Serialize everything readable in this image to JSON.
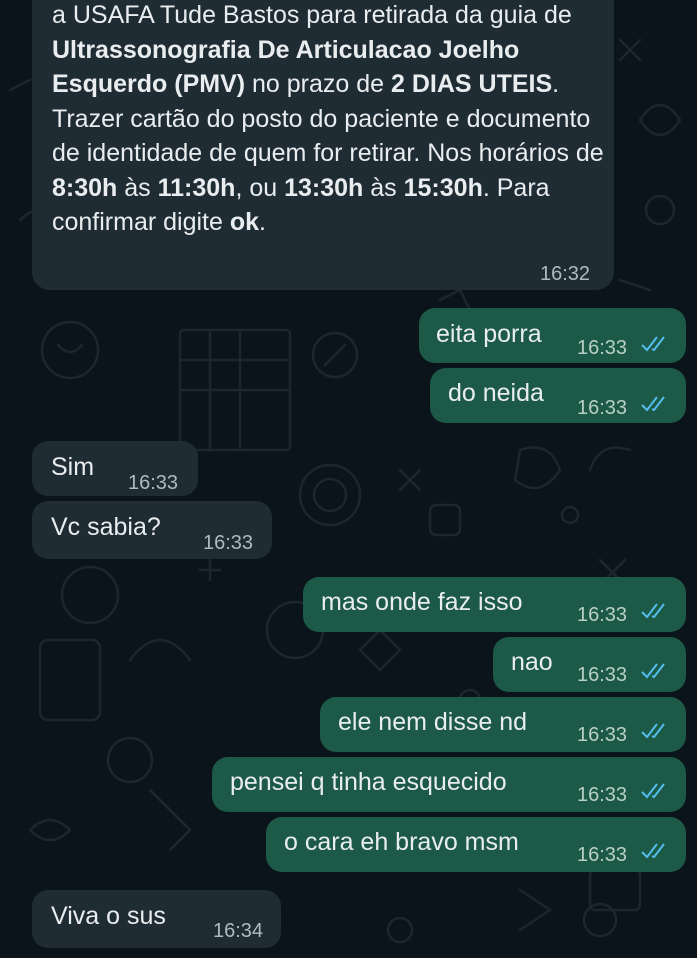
{
  "colors": {
    "background": "#0b141a",
    "incoming_bubble": "#202c33",
    "outgoing_bubble": "#1c5a47",
    "read_ticks": "#53bdeb"
  },
  "first_message": {
    "segments": [
      {
        "t": "a USAFA Tude Bastos para retirada da guia de ",
        "b": false
      },
      {
        "t": "Ultrassonografia De Articulacao Joelho Esquerdo (PMV)",
        "b": true
      },
      {
        "t": " no prazo de ",
        "b": false
      },
      {
        "t": "2 DIAS UTEIS",
        "b": true
      },
      {
        "t": ". Trazer cartão do posto do paciente e documento de identidade de quem for retirar. Nos horários de ",
        "b": false
      },
      {
        "t": "8:30h",
        "b": true
      },
      {
        "t": " às ",
        "b": false
      },
      {
        "t": "11:30h",
        "b": true
      },
      {
        "t": ", ou ",
        "b": false
      },
      {
        "t": "13:30h",
        "b": true
      },
      {
        "t": " às ",
        "b": false
      },
      {
        "t": "15:30h",
        "b": true
      },
      {
        "t": ". Para confirmar digite ",
        "b": false
      },
      {
        "t": "ok",
        "b": true
      },
      {
        "t": ".",
        "b": false
      }
    ],
    "time": "16:32"
  },
  "messages": [
    {
      "text": "eita porra",
      "time": "16:33",
      "outgoing": true,
      "read_icon": "double-check-icon"
    },
    {
      "text": "do neida",
      "time": "16:33",
      "outgoing": true,
      "read_icon": "double-check-icon"
    },
    {
      "text": "Sim",
      "time": "16:33",
      "outgoing": false
    },
    {
      "text": "Vc sabia?",
      "time": "16:33",
      "outgoing": false
    },
    {
      "text": "mas onde faz isso",
      "time": "16:33",
      "outgoing": true,
      "read_icon": "double-check-icon"
    },
    {
      "text": "nao",
      "time": "16:33",
      "outgoing": true,
      "read_icon": "double-check-icon"
    },
    {
      "text": "ele nem disse nd",
      "time": "16:33",
      "outgoing": true,
      "read_icon": "double-check-icon"
    },
    {
      "text": "pensei q tinha esquecido",
      "time": "16:33",
      "outgoing": true,
      "read_icon": "double-check-icon"
    },
    {
      "text": "o cara eh bravo msm",
      "time": "16:33",
      "outgoing": true,
      "read_icon": "double-check-icon"
    },
    {
      "text": "Viva o sus",
      "time": "16:34",
      "outgoing": false
    }
  ]
}
